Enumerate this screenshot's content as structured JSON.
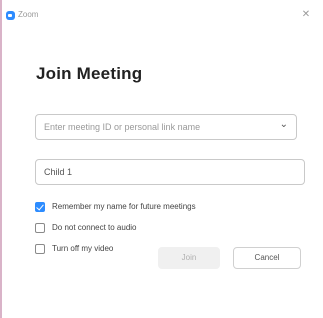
{
  "window": {
    "app_title": "Zoom",
    "close_glyph": "✕"
  },
  "dialog": {
    "heading": "Join Meeting",
    "meeting_field": {
      "placeholder": "Enter meeting ID or personal link name",
      "dropdown_glyph": "⌄"
    },
    "name_field": {
      "value": "Child 1"
    },
    "options": [
      {
        "label": "Remember my name for future meetings",
        "checked": true
      },
      {
        "label": "Do not connect to audio",
        "checked": false
      },
      {
        "label": "Turn off my video",
        "checked": false
      }
    ],
    "buttons": {
      "join": "Join",
      "cancel": "Cancel"
    }
  },
  "colors": {
    "accent": "#2d8cff",
    "disabled_bg": "#f0f0f0"
  }
}
